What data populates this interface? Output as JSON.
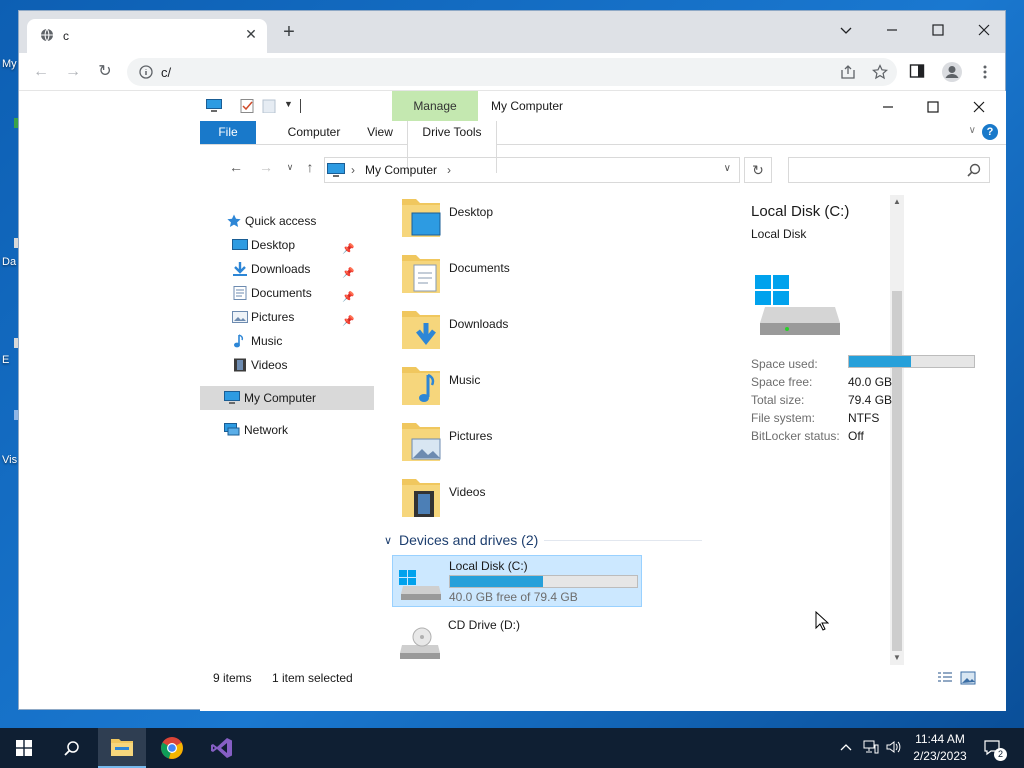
{
  "desktop": {
    "edge_labels": [
      "My",
      "Da",
      "E",
      "Vis"
    ]
  },
  "browser": {
    "tab_title": "c",
    "url": "c/",
    "icons": [
      "globe-icon",
      "close-icon",
      "new-tab-icon",
      "minimize-icon",
      "maximize-icon",
      "close-window-icon",
      "back-icon",
      "forward-icon",
      "reload-icon",
      "info-icon",
      "share-icon",
      "bookmark-star-icon",
      "side-panel-icon",
      "profile-icon",
      "menu-kebab-icon"
    ]
  },
  "explorer": {
    "window_title": "My Computer",
    "manage_tab": "Manage",
    "ribbon_tabs": {
      "file": "File",
      "computer": "Computer",
      "view": "View",
      "drive_tools": "Drive Tools"
    },
    "help_label": "?",
    "address_breadcrumb": "My Computer",
    "search_placeholder": "",
    "nav": {
      "quick_access": "Quick access",
      "items": [
        {
          "label": "Desktop",
          "icon": "desktop-icon",
          "pinned": true
        },
        {
          "label": "Downloads",
          "icon": "downloads-icon",
          "pinned": true
        },
        {
          "label": "Documents",
          "icon": "documents-icon",
          "pinned": true
        },
        {
          "label": "Pictures",
          "icon": "pictures-icon",
          "pinned": true
        },
        {
          "label": "Music",
          "icon": "music-icon",
          "pinned": false
        },
        {
          "label": "Videos",
          "icon": "videos-icon",
          "pinned": false
        }
      ],
      "my_computer": "My Computer",
      "network": "Network"
    },
    "folders": [
      {
        "name": "Desktop",
        "icon": "folder-desktop-icon"
      },
      {
        "name": "Documents",
        "icon": "folder-documents-icon"
      },
      {
        "name": "Downloads",
        "icon": "folder-downloads-icon"
      },
      {
        "name": "Music",
        "icon": "folder-music-icon"
      },
      {
        "name": "Pictures",
        "icon": "folder-pictures-icon"
      },
      {
        "name": "Videos",
        "icon": "folder-videos-icon"
      }
    ],
    "devices_group": "Devices and drives (2)",
    "drives": [
      {
        "name": "Local Disk (C:)",
        "subtitle": "40.0 GB free of 79.4 GB",
        "used_fraction": 0.496,
        "selected": true
      },
      {
        "name": "CD Drive (D:)",
        "subtitle": "",
        "selected": false
      }
    ],
    "details": {
      "title": "Local Disk (C:)",
      "subtitle": "Local Disk",
      "space_used_label": "Space used:",
      "used_fraction": 0.496,
      "rows": [
        {
          "k": "Space free:",
          "v": "40.0 GB"
        },
        {
          "k": "Total size:",
          "v": "79.4 GB"
        },
        {
          "k": "File system:",
          "v": "NTFS"
        },
        {
          "k": "BitLocker status:",
          "v": "Off"
        }
      ]
    },
    "status": {
      "items": "9 items",
      "selected": "1 item selected"
    },
    "colors": {
      "accent": "#1979ca",
      "manage": "#c4e8b0",
      "bar_fill": "#26a0da",
      "selection": "#cce8ff"
    }
  },
  "taskbar": {
    "time": "11:44 AM",
    "date": "2/23/2023",
    "notification_count": "2",
    "apps": [
      "start-button",
      "search-button",
      "file-explorer-app",
      "chrome-app",
      "visual-studio-app"
    ]
  }
}
